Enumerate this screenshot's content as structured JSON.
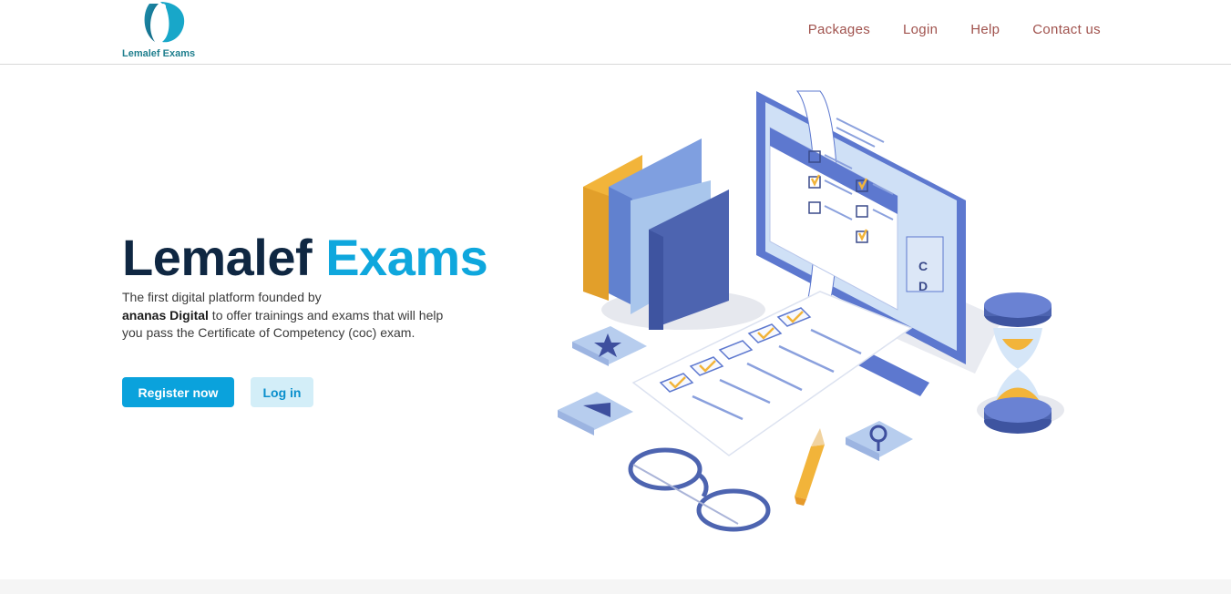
{
  "header": {
    "logo_text": "Lemalef Exams",
    "nav": [
      {
        "label": "Packages"
      },
      {
        "label": "Login"
      },
      {
        "label": "Help"
      },
      {
        "label": "Contact us"
      }
    ]
  },
  "hero": {
    "title_part1": "Lemalef",
    "title_part2": "Exams",
    "desc_line1": "The first digital platform founded by",
    "desc_bold": "ananas Digital",
    "desc_rest": " to offer trainings and exams that will help you pass the Certificate of Competency (coc) exam.",
    "register_label": "Register now",
    "login_label": "Log in"
  },
  "illustration": {
    "answer_letters": [
      "C",
      "D"
    ]
  },
  "colors": {
    "brand_dark": "#0f2742",
    "brand_accent": "#0fa7dd",
    "nav_text": "#a0524d",
    "illustration_blue": "#5468b8",
    "illustration_yellow": "#f2b43a"
  }
}
